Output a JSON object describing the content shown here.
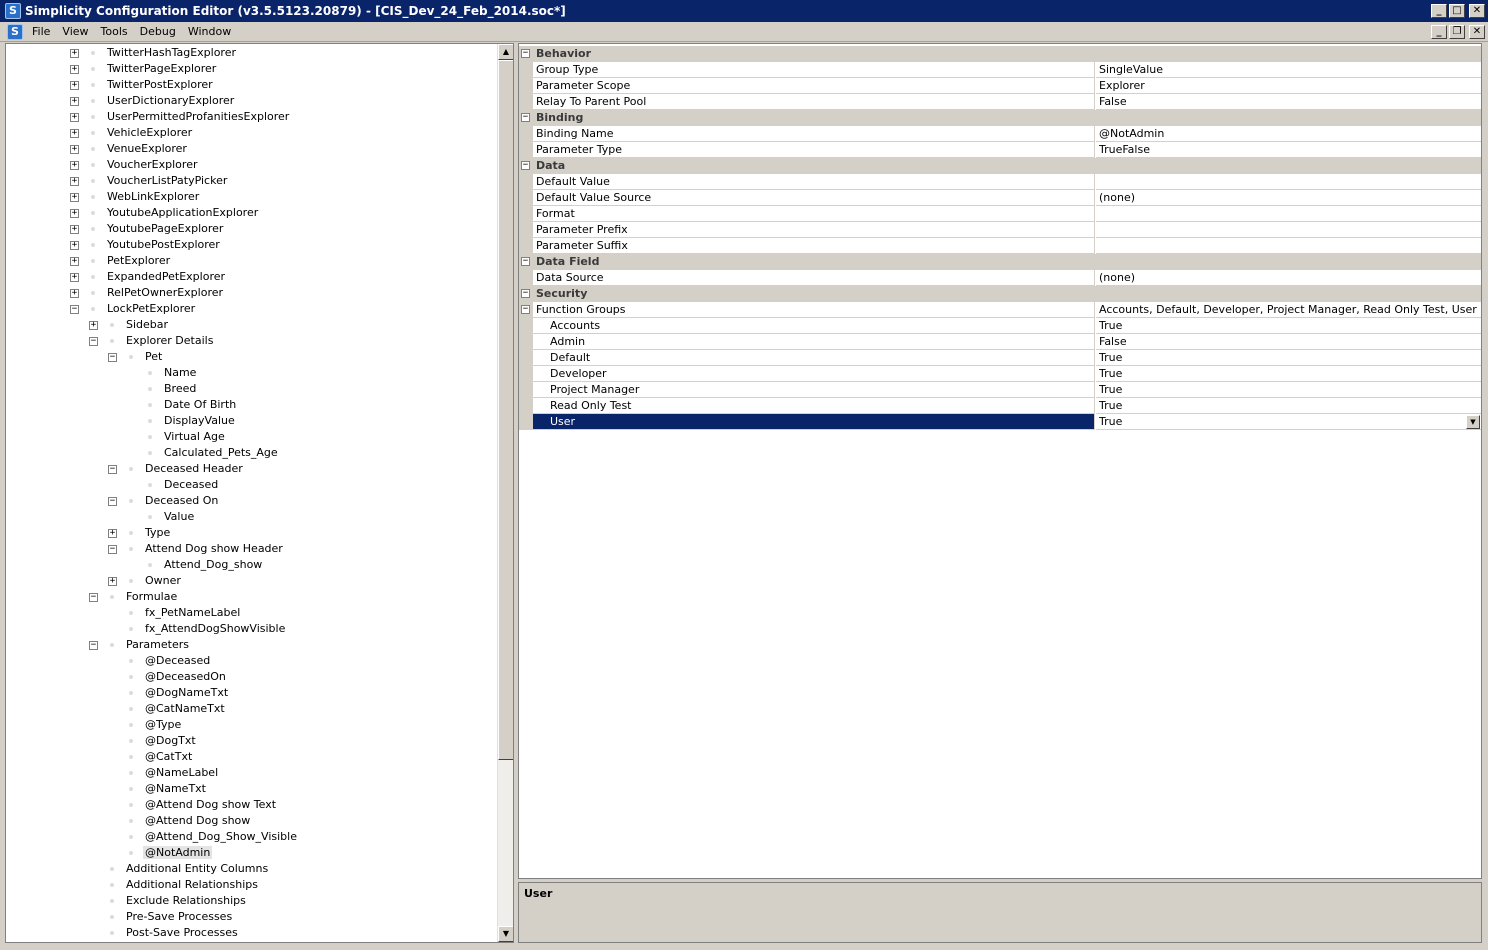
{
  "titlebar": {
    "title": "Simplicity Configuration Editor (v3.5.5123.20879) - [CIS_Dev_24_Feb_2014.soc*]",
    "icon_letter": "S",
    "minimize": "_",
    "maximize": "□",
    "close": "✕"
  },
  "menubar": {
    "icon_letter": "S",
    "items": [
      "File",
      "View",
      "Tools",
      "Debug",
      "Window"
    ],
    "mdi_minimize": "_",
    "mdi_restore": "❐",
    "mdi_close": "✕"
  },
  "tree": {
    "nodes": [
      {
        "label": "TwitterHashTagExplorer",
        "level": 0,
        "state": "collapsed"
      },
      {
        "label": "TwitterPageExplorer",
        "level": 0,
        "state": "collapsed"
      },
      {
        "label": "TwitterPostExplorer",
        "level": 0,
        "state": "collapsed"
      },
      {
        "label": "UserDictionaryExplorer",
        "level": 0,
        "state": "collapsed"
      },
      {
        "label": "UserPermittedProfanitiesExplorer",
        "level": 0,
        "state": "collapsed"
      },
      {
        "label": "VehicleExplorer",
        "level": 0,
        "state": "collapsed"
      },
      {
        "label": "VenueExplorer",
        "level": 0,
        "state": "collapsed"
      },
      {
        "label": "VoucherExplorer",
        "level": 0,
        "state": "collapsed"
      },
      {
        "label": "VoucherListPatyPicker",
        "level": 0,
        "state": "collapsed"
      },
      {
        "label": "WebLinkExplorer",
        "level": 0,
        "state": "collapsed"
      },
      {
        "label": "YoutubeApplicationExplorer",
        "level": 0,
        "state": "collapsed"
      },
      {
        "label": "YoutubePageExplorer",
        "level": 0,
        "state": "collapsed"
      },
      {
        "label": "YoutubePostExplorer",
        "level": 0,
        "state": "collapsed"
      },
      {
        "label": "PetExplorer",
        "level": 0,
        "state": "collapsed"
      },
      {
        "label": "ExpandedPetExplorer",
        "level": 0,
        "state": "collapsed"
      },
      {
        "label": "RelPetOwnerExplorer",
        "level": 0,
        "state": "collapsed"
      },
      {
        "label": "LockPetExplorer",
        "level": 0,
        "state": "expanded"
      },
      {
        "label": "Sidebar",
        "level": 1,
        "state": "collapsed"
      },
      {
        "label": "Explorer Details",
        "level": 1,
        "state": "expanded"
      },
      {
        "label": "Pet",
        "level": 2,
        "state": "expanded"
      },
      {
        "label": "Name",
        "level": 3,
        "state": "leaf"
      },
      {
        "label": "Breed",
        "level": 3,
        "state": "leaf"
      },
      {
        "label": "Date Of Birth",
        "level": 3,
        "state": "leaf"
      },
      {
        "label": "DisplayValue",
        "level": 3,
        "state": "leaf"
      },
      {
        "label": "Virtual Age",
        "level": 3,
        "state": "leaf"
      },
      {
        "label": "Calculated_Pets_Age",
        "level": 3,
        "state": "leaf"
      },
      {
        "label": "Deceased Header",
        "level": 2,
        "state": "expanded"
      },
      {
        "label": "Deceased",
        "level": 3,
        "state": "leaf"
      },
      {
        "label": "Deceased On",
        "level": 2,
        "state": "expanded"
      },
      {
        "label": "Value",
        "level": 3,
        "state": "leaf"
      },
      {
        "label": "Type",
        "level": 2,
        "state": "collapsed"
      },
      {
        "label": "Attend Dog show Header",
        "level": 2,
        "state": "expanded"
      },
      {
        "label": "Attend_Dog_show",
        "level": 3,
        "state": "leaf"
      },
      {
        "label": "Owner",
        "level": 2,
        "state": "collapsed"
      },
      {
        "label": "Formulae",
        "level": 1,
        "state": "expanded"
      },
      {
        "label": "fx_PetNameLabel",
        "level": 2,
        "state": "leaf"
      },
      {
        "label": "fx_AttendDogShowVisible",
        "level": 2,
        "state": "leaf"
      },
      {
        "label": "Parameters",
        "level": 1,
        "state": "expanded"
      },
      {
        "label": "@Deceased",
        "level": 2,
        "state": "leaf"
      },
      {
        "label": "@DeceasedOn",
        "level": 2,
        "state": "leaf"
      },
      {
        "label": "@DogNameTxt",
        "level": 2,
        "state": "leaf"
      },
      {
        "label": "@CatNameTxt",
        "level": 2,
        "state": "leaf"
      },
      {
        "label": "@Type",
        "level": 2,
        "state": "leaf"
      },
      {
        "label": "@DogTxt",
        "level": 2,
        "state": "leaf"
      },
      {
        "label": "@CatTxt",
        "level": 2,
        "state": "leaf"
      },
      {
        "label": "@NameLabel",
        "level": 2,
        "state": "leaf"
      },
      {
        "label": "@NameTxt",
        "level": 2,
        "state": "leaf"
      },
      {
        "label": "@Attend Dog show Text",
        "level": 2,
        "state": "leaf"
      },
      {
        "label": "@Attend Dog show",
        "level": 2,
        "state": "leaf"
      },
      {
        "label": "@Attend_Dog_Show_Visible",
        "level": 2,
        "state": "leaf"
      },
      {
        "label": "@NotAdmin",
        "level": 2,
        "state": "leaf",
        "selected": true
      },
      {
        "label": "Additional Entity Columns",
        "level": 1,
        "state": "leaf"
      },
      {
        "label": "Additional Relationships",
        "level": 1,
        "state": "leaf"
      },
      {
        "label": "Exclude Relationships",
        "level": 1,
        "state": "leaf"
      },
      {
        "label": "Pre-Save Processes",
        "level": 1,
        "state": "leaf"
      },
      {
        "label": "Post-Save Processes",
        "level": 1,
        "state": "leaf"
      }
    ]
  },
  "properties": {
    "rows": [
      {
        "kind": "category",
        "label": "Behavior"
      },
      {
        "kind": "prop",
        "name": "Group Type",
        "value": "SingleValue"
      },
      {
        "kind": "prop",
        "name": "Parameter Scope",
        "value": "Explorer"
      },
      {
        "kind": "prop",
        "name": "Relay To Parent Pool",
        "value": "False"
      },
      {
        "kind": "category",
        "label": "Binding"
      },
      {
        "kind": "prop",
        "name": "Binding Name",
        "value": "@NotAdmin"
      },
      {
        "kind": "prop",
        "name": "Parameter Type",
        "value": "TrueFalse"
      },
      {
        "kind": "category",
        "label": "Data"
      },
      {
        "kind": "prop",
        "name": "Default Value",
        "value": ""
      },
      {
        "kind": "prop",
        "name": "Default Value Source",
        "value": "(none)"
      },
      {
        "kind": "prop",
        "name": "Format",
        "value": ""
      },
      {
        "kind": "prop",
        "name": "Parameter Prefix",
        "value": ""
      },
      {
        "kind": "prop",
        "name": "Parameter Suffix",
        "value": ""
      },
      {
        "kind": "category",
        "label": "Data Field"
      },
      {
        "kind": "prop",
        "name": "Data Source",
        "value": "(none)"
      },
      {
        "kind": "category",
        "label": "Security"
      },
      {
        "kind": "prop",
        "name": "Function Groups",
        "value": "Accounts, Default, Developer, Project Manager, Read Only Test, User",
        "expandable": true
      },
      {
        "kind": "prop",
        "name": "Accounts",
        "value": "True",
        "indent": true
      },
      {
        "kind": "prop",
        "name": "Admin",
        "value": "False",
        "indent": true
      },
      {
        "kind": "prop",
        "name": "Default",
        "value": "True",
        "indent": true
      },
      {
        "kind": "prop",
        "name": "Developer",
        "value": "True",
        "indent": true
      },
      {
        "kind": "prop",
        "name": "Project Manager",
        "value": "True",
        "indent": true
      },
      {
        "kind": "prop",
        "name": "Read Only Test",
        "value": "True",
        "indent": true
      },
      {
        "kind": "prop",
        "name": "User",
        "value": "True",
        "indent": true,
        "selected": true
      }
    ]
  },
  "description": {
    "title": "User"
  },
  "colors": {
    "titlebar": "#0a246a",
    "selection": "#0a246a",
    "chrome": "#d4d0c8"
  }
}
